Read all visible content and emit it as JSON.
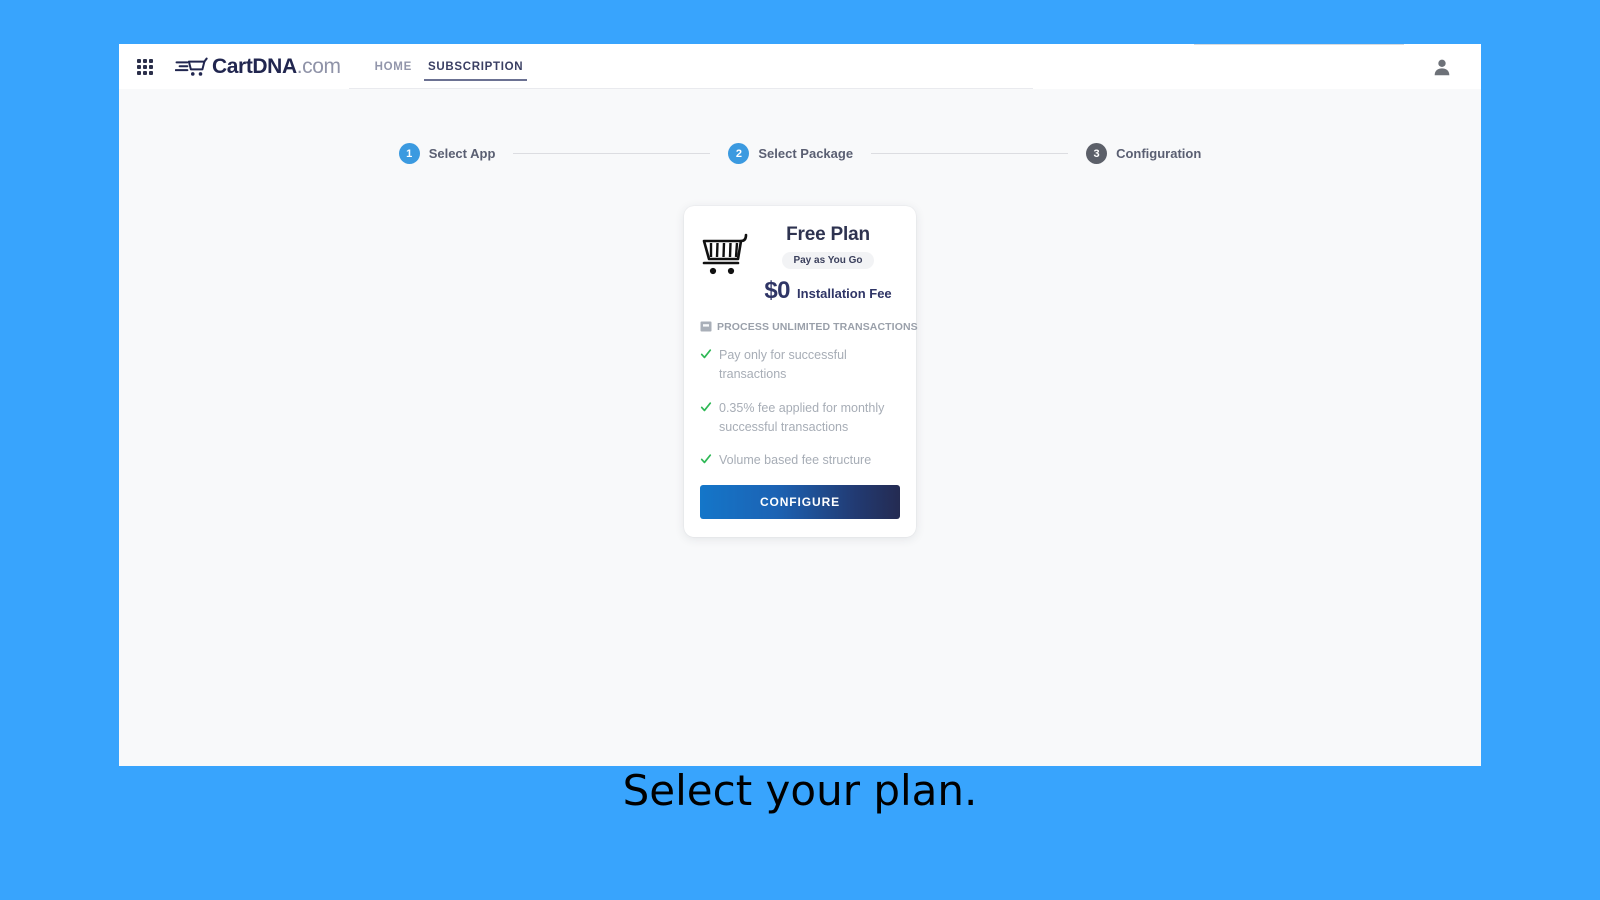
{
  "page": {
    "background_color": "#38a4fd",
    "caption": "Select your plan."
  },
  "topbar": {
    "apps_grid_icon": "grid-apps-icon",
    "brand_name": "CartDNA",
    "brand_tld": ".com",
    "brand_mark_icon": "fast-cart-logo-icon",
    "avatar_icon": "user-avatar-icon",
    "nav": [
      {
        "label": "HOME",
        "active": false
      },
      {
        "label": "SUBSCRIPTION",
        "active": true
      }
    ]
  },
  "stepper": {
    "steps": [
      {
        "number": "1",
        "label": "Select App",
        "state": "active",
        "color": "#3b9ae0"
      },
      {
        "number": "2",
        "label": "Select Package",
        "state": "active",
        "color": "#3b9ae0"
      },
      {
        "number": "3",
        "label": "Configuration",
        "state": "inactive",
        "color": "#5c6069"
      }
    ]
  },
  "plan_card": {
    "icon": "shopping-cart-icon",
    "title": "Free Plan",
    "badge": "Pay as You Go",
    "price": "$0",
    "price_label": "Installation Fee",
    "subhead_icon": "transactions-card-icon",
    "subhead": "PROCESS UNLIMITED TRANSACTIONS",
    "features": [
      {
        "icon": "check-icon",
        "text": "Pay only for successful transactions"
      },
      {
        "icon": "check-icon",
        "text": "0.35% fee applied for monthly successful transactions"
      },
      {
        "icon": "check-icon",
        "text": "Volume based fee structure"
      }
    ],
    "cta_label": "CONFIGURE",
    "cta_gradient_from": "#1476c9",
    "cta_gradient_to": "#242b52",
    "check_color": "#2eb855"
  }
}
